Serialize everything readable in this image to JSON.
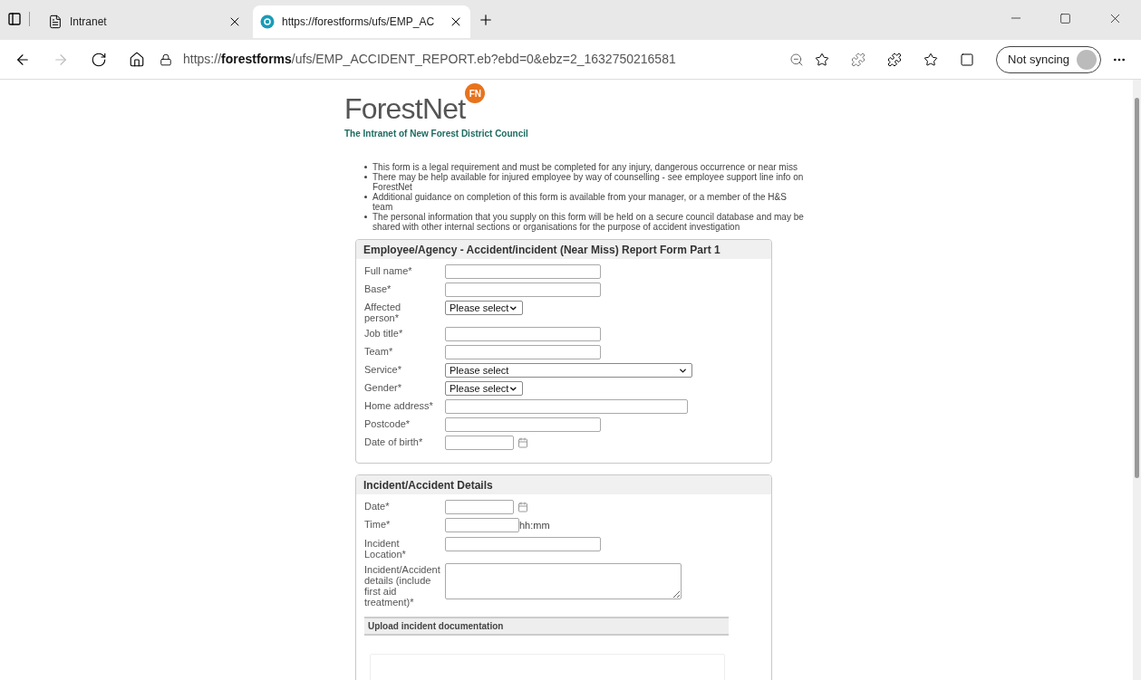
{
  "browser": {
    "tabs": [
      {
        "title": "Intranet",
        "selected": false,
        "kind": "page"
      },
      {
        "title": "https://forestforms/ufs/EMP_AC",
        "selected": true,
        "kind": "site"
      }
    ],
    "address": {
      "prefix": "https://",
      "host": "forestforms",
      "path": "/ufs/EMP_ACCIDENT_REPORT.eb?ebd=0&ebz=2_1632750216581"
    },
    "profile_button": "Not syncing"
  },
  "page": {
    "logo": {
      "name": "ForestNet",
      "badge": "FN",
      "tagline": "The Intranet of New Forest District Council"
    },
    "notes": [
      "This form is a legal requirement and must be completed for any injury, dangerous occurrence or near miss",
      "There may be help available for injured employee by way of counselling - see employee support line info on ForestNet",
      "Additional guidance on completion of this form is available from your manager, or a member of the H&S team",
      "The personal information that you supply on this form will be held on a secure council database and may be shared with other internal sections or organisations for the purpose of accident investigation"
    ],
    "sections": [
      {
        "title": "Employee/Agency - Accident/incident (Near Miss) Report Form Part 1",
        "fields": [
          {
            "label": "Full name*",
            "kind": "text"
          },
          {
            "label": "Base*",
            "kind": "text"
          },
          {
            "label": "Affected person*",
            "kind": "select",
            "value": "Please select"
          },
          {
            "label": "Job title*",
            "kind": "text"
          },
          {
            "label": "Team*",
            "kind": "text"
          },
          {
            "label": "Service*",
            "kind": "wideselect",
            "value": "Please select"
          },
          {
            "label": "Gender*",
            "kind": "select",
            "value": "Please select"
          },
          {
            "label": "Home address*",
            "kind": "widetext"
          },
          {
            "label": "Postcode*",
            "kind": "text"
          },
          {
            "label": "Date of birth*",
            "kind": "date"
          }
        ]
      },
      {
        "title": "Incident/Accident Details",
        "fields": [
          {
            "label": "Date*",
            "kind": "date"
          },
          {
            "label": "Time*",
            "kind": "time",
            "hint": "hh:mm"
          },
          {
            "label": "Incident Location*",
            "kind": "text"
          },
          {
            "label": "Incident/Accident details (include first aid treatment)*",
            "kind": "textarea"
          }
        ],
        "subsection": "Upload incident documentation"
      }
    ]
  }
}
